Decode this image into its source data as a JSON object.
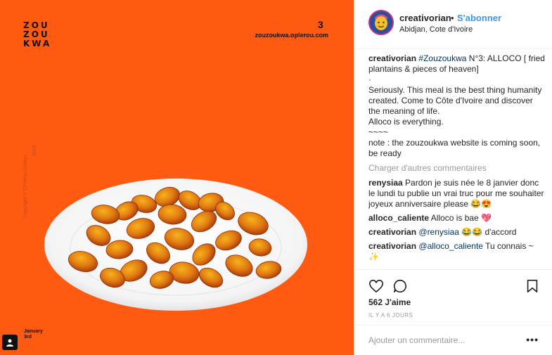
{
  "image": {
    "logo_lines": [
      "ZOU",
      "ZOU",
      "KWA"
    ],
    "number": "3",
    "site": "zouzoukwa.oplerou.com",
    "copyright": "Copyright © O'Plérou Grebet",
    "year": "2018",
    "date_line1": "January",
    "date_line2": "3rd",
    "background_color": "#ff5a12"
  },
  "header": {
    "username": "creativorian",
    "dot": "•",
    "follow_label": "S'abonner",
    "location": "Abidjan, Cote d'Ivoire"
  },
  "caption": {
    "username": "creativorian",
    "hashtag": "#Zouzoukwa",
    "text_1": " N°3: ALLOCO [ fried plantains & pieces of heaven]",
    "line_2": "·",
    "line_3": "Seriously. This meal is the best thing humanity created. Come to Côte d'Ivoire and discover the meaning of life.",
    "line_4": "Alloco is everything.",
    "line_5": "~~~~",
    "line_6": "note : the zouzoukwa website is coming soon, be ready"
  },
  "load_more": "Charger d'autres commentaires",
  "comments": [
    {
      "user": "renysiaa",
      "mention": "",
      "text": " Pardon je suis née le 8 janvier donc le lundi tu publie un vrai truc pour me souhaiter joyeux anniversaire please 😂😍"
    },
    {
      "user": "alloco_caliente",
      "mention": "",
      "text": " Alloco is bae 💖"
    },
    {
      "user": "creativorian",
      "mention": " @renysiaa",
      "text": " 😂😂 d'accord"
    },
    {
      "user": "creativorian",
      "mention": " @alloco_caliente",
      "text": " Tu connais ~ ✨"
    }
  ],
  "actions": {
    "likes": "562 J'aime",
    "time": "IL Y A 6 JOURS"
  },
  "add_comment": {
    "placeholder": "Ajouter un commentaire...",
    "more": "•••"
  }
}
